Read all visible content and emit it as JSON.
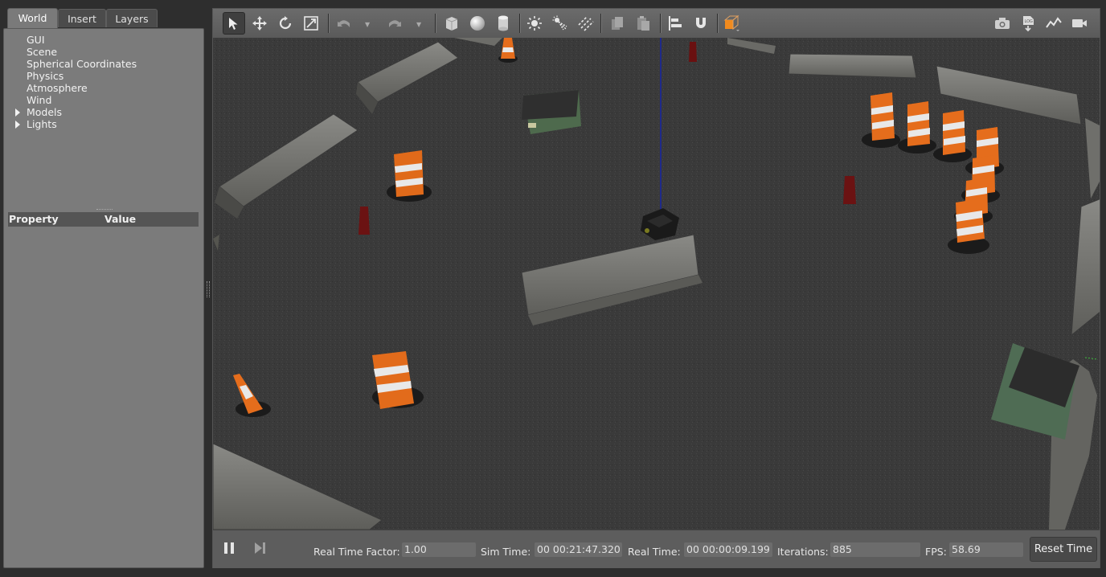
{
  "left_panel": {
    "tabs": [
      {
        "label": "World",
        "active": true
      },
      {
        "label": "Insert",
        "active": false
      },
      {
        "label": "Layers",
        "active": false
      }
    ],
    "tree": [
      {
        "label": "GUI",
        "expandable": false
      },
      {
        "label": "Scene",
        "expandable": false
      },
      {
        "label": "Spherical Coordinates",
        "expandable": false
      },
      {
        "label": "Physics",
        "expandable": false
      },
      {
        "label": "Atmosphere",
        "expandable": false
      },
      {
        "label": "Wind",
        "expandable": false
      },
      {
        "label": "Models",
        "expandable": true
      },
      {
        "label": "Lights",
        "expandable": true
      }
    ],
    "property_header": {
      "property": "Property",
      "value": "Value"
    }
  },
  "toolbar": {
    "tools": [
      "select-arrow-icon",
      "translate-icon",
      "rotate-icon",
      "scale-icon",
      "undo-icon",
      "redo-icon",
      "box-icon",
      "sphere-icon",
      "cylinder-icon",
      "point-light-icon",
      "spot-light-icon",
      "directional-light-icon",
      "copy-icon",
      "paste-icon",
      "align-icon",
      "magnet-icon",
      "view-angle-icon"
    ],
    "right_tools": [
      "screenshot-icon",
      "log-icon",
      "plot-icon",
      "record-video-icon"
    ],
    "colors": {
      "accent_orange": "#f28b1e"
    }
  },
  "status_bar": {
    "real_time_factor_label": "Real Time Factor:",
    "real_time_factor": "1.00",
    "sim_time_label": "Sim Time:",
    "sim_time": "00 00:21:47.320",
    "real_time_label": "Real Time:",
    "real_time": "00 00:00:09.199",
    "iterations_label": "Iterations:",
    "iterations": "885",
    "fps_label": "FPS:",
    "fps": "58.69",
    "reset_label": "Reset Time"
  }
}
